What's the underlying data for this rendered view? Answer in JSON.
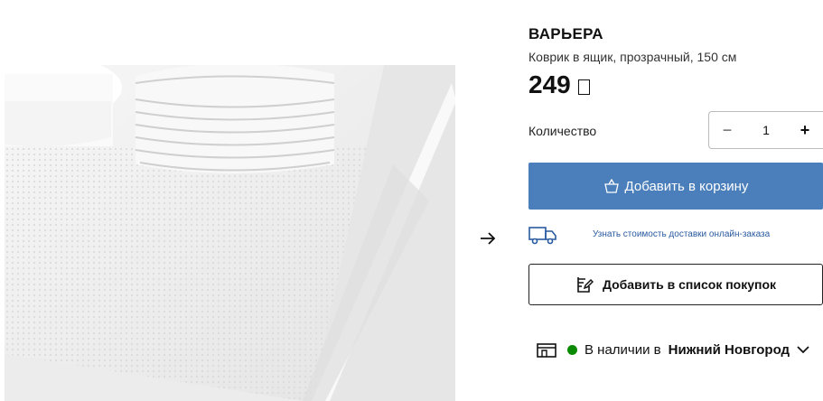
{
  "product": {
    "name": "ВАРЬЕРА",
    "description": "Коврик в ящик, прозрачный, 150 см",
    "price": "249"
  },
  "quantity": {
    "label": "Количество",
    "value": "1",
    "minus": "−",
    "plus": "+"
  },
  "actions": {
    "add_to_cart": "Добавить в корзину",
    "delivery_link": "Узнать стоимость доставки онлайн-заказа",
    "add_to_list": "Добавить в список покупок"
  },
  "stock": {
    "prefix": "В наличии в",
    "city": "Нижний Новгород",
    "status_color": "#0a8a00"
  },
  "colors": {
    "accent": "#4a7fbb"
  },
  "icons": [
    "arrow-right-icon",
    "bag-icon",
    "truck-icon",
    "edit-list-icon",
    "store-icon",
    "chevron-down-icon"
  ]
}
